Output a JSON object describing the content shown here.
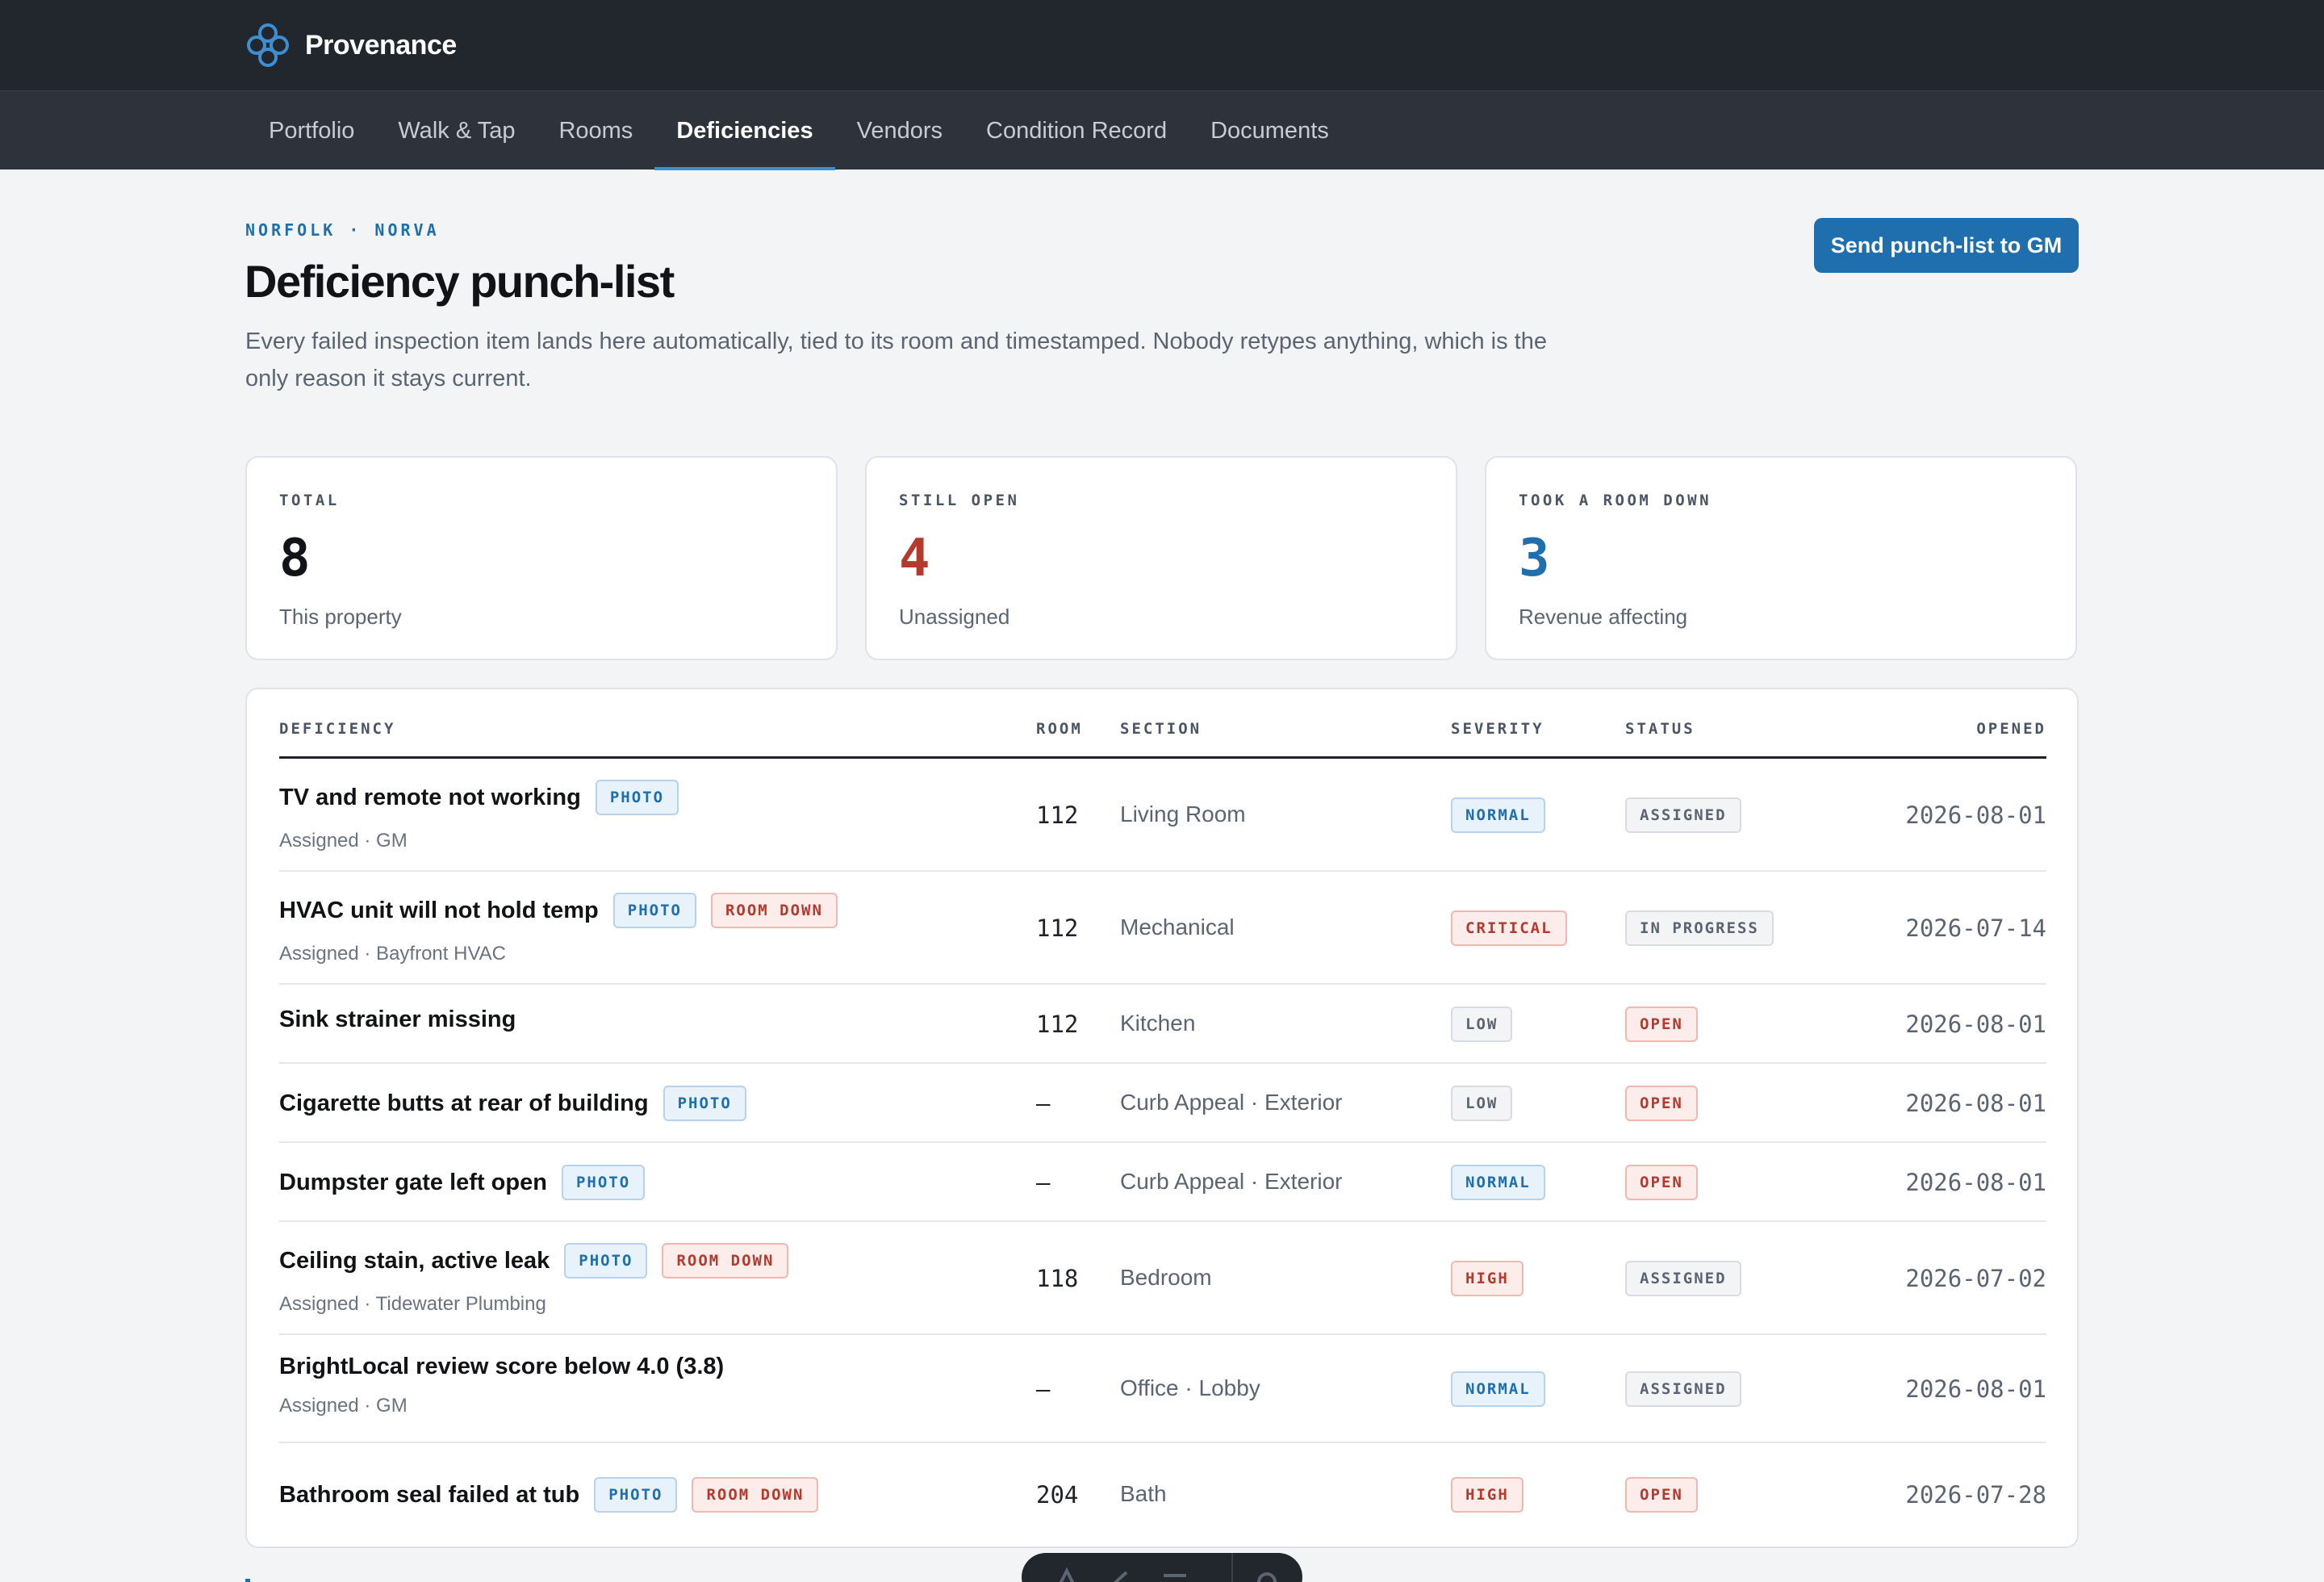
{
  "app": {
    "name": "Provenance"
  },
  "nav": {
    "tabs": [
      {
        "label": "Portfolio"
      },
      {
        "label": "Walk & Tap"
      },
      {
        "label": "Rooms"
      },
      {
        "label": "Deficiencies",
        "active": true
      },
      {
        "label": "Vendors"
      },
      {
        "label": "Condition Record"
      },
      {
        "label": "Documents"
      }
    ]
  },
  "header": {
    "eyebrow": "NORFOLK · NORVA",
    "title": "Deficiency punch-list",
    "lead": "Every failed inspection item lands here automatically, tied to its room and timestamped. Nobody retypes anything, which is the only reason it stays current.",
    "cta_label": "Send punch-list to GM"
  },
  "stats": [
    {
      "label": "TOTAL",
      "value": "8",
      "sub": "This property",
      "color": "#111317"
    },
    {
      "label": "STILL OPEN",
      "value": "4",
      "sub": "Unassigned",
      "color": "#b43a2e"
    },
    {
      "label": "TOOK A ROOM DOWN",
      "value": "3",
      "sub": "Revenue affecting",
      "color": "#1f6fae"
    }
  ],
  "table": {
    "columns": {
      "deficiency": "DEFICIENCY",
      "room": "ROOM",
      "section": "SECTION",
      "severity": "SEVERITY",
      "status": "STATUS",
      "opened": "OPENED"
    },
    "rows": [
      {
        "title": "TV and remote not working",
        "tags": [
          "PHOTO"
        ],
        "sub": "Assigned · GM",
        "room": "112",
        "section": "Living Room",
        "severity": "NORMAL",
        "status": "ASSIGNED",
        "opened": "2026-08-01"
      },
      {
        "title": "HVAC unit will not hold temp",
        "tags": [
          "PHOTO",
          "ROOM DOWN"
        ],
        "sub": "Assigned · Bayfront HVAC",
        "room": "112",
        "section": "Mechanical",
        "severity": "CRITICAL",
        "status": "IN PROGRESS",
        "opened": "2026-07-14"
      },
      {
        "title": "Sink strainer missing",
        "tags": [],
        "sub": "",
        "room": "112",
        "section": "Kitchen",
        "severity": "LOW",
        "status": "OPEN",
        "opened": "2026-08-01"
      },
      {
        "title": "Cigarette butts at rear of building",
        "tags": [
          "PHOTO"
        ],
        "sub": "",
        "room": "—",
        "section": "Curb Appeal · Exterior",
        "severity": "LOW",
        "status": "OPEN",
        "opened": "2026-08-01"
      },
      {
        "title": "Dumpster gate left open",
        "tags": [
          "PHOTO"
        ],
        "sub": "",
        "room": "—",
        "section": "Curb Appeal · Exterior",
        "severity": "NORMAL",
        "status": "OPEN",
        "opened": "2026-08-01"
      },
      {
        "title": "Ceiling stain, active leak",
        "tags": [
          "PHOTO",
          "ROOM DOWN"
        ],
        "sub": "Assigned · Tidewater Plumbing",
        "room": "118",
        "section": "Bedroom",
        "severity": "HIGH",
        "status": "ASSIGNED",
        "opened": "2026-07-02"
      },
      {
        "title": "BrightLocal review score below 4.0 (3.8)",
        "tags": [],
        "sub": "Assigned · GM",
        "room": "—",
        "section": "Office · Lobby",
        "severity": "NORMAL",
        "status": "ASSIGNED",
        "opened": "2026-08-01"
      },
      {
        "title": "Bathroom seal failed at tub",
        "tags": [
          "PHOTO",
          "ROOM DOWN"
        ],
        "sub": "",
        "room": "204",
        "section": "Bath",
        "severity": "HIGH",
        "status": "OPEN",
        "opened": "2026-07-28"
      }
    ]
  },
  "colors": {
    "topbar": "#22262d",
    "nav": "#2e333b",
    "accent": "#1f6fae",
    "danger": "#b43a2e"
  }
}
